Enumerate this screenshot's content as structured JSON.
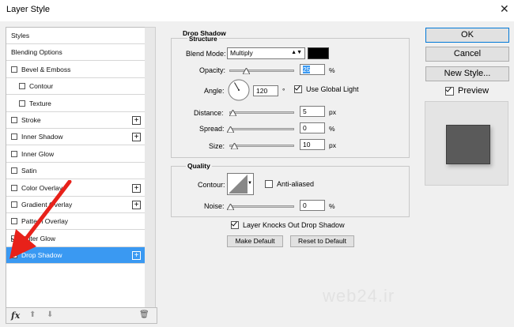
{
  "window": {
    "title": "Layer Style",
    "close_icon": "✕"
  },
  "styles_list": [
    {
      "label": "Styles",
      "checkbox": false,
      "checked": false,
      "plus": false,
      "indent": false,
      "selected": false
    },
    {
      "label": "Blending Options",
      "checkbox": false,
      "checked": false,
      "plus": false,
      "indent": false,
      "selected": false
    },
    {
      "label": "Bevel & Emboss",
      "checkbox": true,
      "checked": false,
      "plus": false,
      "indent": false,
      "selected": false
    },
    {
      "label": "Contour",
      "checkbox": true,
      "checked": false,
      "plus": false,
      "indent": true,
      "selected": false
    },
    {
      "label": "Texture",
      "checkbox": true,
      "checked": false,
      "plus": false,
      "indent": true,
      "selected": false
    },
    {
      "label": "Stroke",
      "checkbox": true,
      "checked": false,
      "plus": true,
      "indent": false,
      "selected": false
    },
    {
      "label": "Inner Shadow",
      "checkbox": true,
      "checked": false,
      "plus": true,
      "indent": false,
      "selected": false
    },
    {
      "label": "Inner Glow",
      "checkbox": true,
      "checked": false,
      "plus": false,
      "indent": false,
      "selected": false
    },
    {
      "label": "Satin",
      "checkbox": true,
      "checked": false,
      "plus": false,
      "indent": false,
      "selected": false
    },
    {
      "label": "Color Overlay",
      "checkbox": true,
      "checked": false,
      "plus": true,
      "indent": false,
      "selected": false
    },
    {
      "label": "Gradient Overlay",
      "checkbox": true,
      "checked": false,
      "plus": true,
      "indent": false,
      "selected": false
    },
    {
      "label": "Pattern Overlay",
      "checkbox": true,
      "checked": false,
      "plus": false,
      "indent": false,
      "selected": false
    },
    {
      "label": "Outer Glow",
      "checkbox": true,
      "checked": true,
      "plus": false,
      "indent": false,
      "selected": false
    },
    {
      "label": "Drop Shadow",
      "checkbox": true,
      "checked": true,
      "plus": true,
      "indent": false,
      "selected": true
    }
  ],
  "bottom_bar": {
    "fx_label": "fx",
    "up_icon": "⬆",
    "down_icon": "⬇",
    "trash_icon": "🗑"
  },
  "drop_shadow": {
    "title": "Drop Shadow",
    "structure_title": "Structure",
    "blend_mode_label": "Blend Mode:",
    "blend_mode_value": "Multiply",
    "shadow_color": "#000000",
    "opacity_label": "Opacity:",
    "opacity_value": "25",
    "opacity_unit": "%",
    "opacity_fraction": 0.25,
    "angle_label": "Angle:",
    "angle_value": "120",
    "angle_unit": "°",
    "use_global_light_label": "Use Global Light",
    "use_global_light_checked": true,
    "distance_label": "Distance:",
    "distance_value": "5",
    "distance_unit": "px",
    "spread_label": "Spread:",
    "spread_value": "0",
    "spread_unit": "%",
    "size_label": "Size:",
    "size_value": "10",
    "size_unit": "px",
    "quality_title": "Quality",
    "contour_label": "Contour:",
    "anti_aliased_label": "Anti-aliased",
    "anti_aliased_checked": false,
    "noise_label": "Noise:",
    "noise_value": "0",
    "noise_unit": "%",
    "knocks_out_label": "Layer Knocks Out Drop Shadow",
    "knocks_out_checked": true,
    "make_default_label": "Make Default",
    "reset_default_label": "Reset to Default"
  },
  "right_panel": {
    "ok_label": "OK",
    "cancel_label": "Cancel",
    "new_style_label": "New Style...",
    "preview_label": "Preview",
    "preview_checked": true,
    "preview_swatch_color": "#5a5a5a"
  },
  "watermark": "web24.ir",
  "accent_color": "#3a99f2"
}
